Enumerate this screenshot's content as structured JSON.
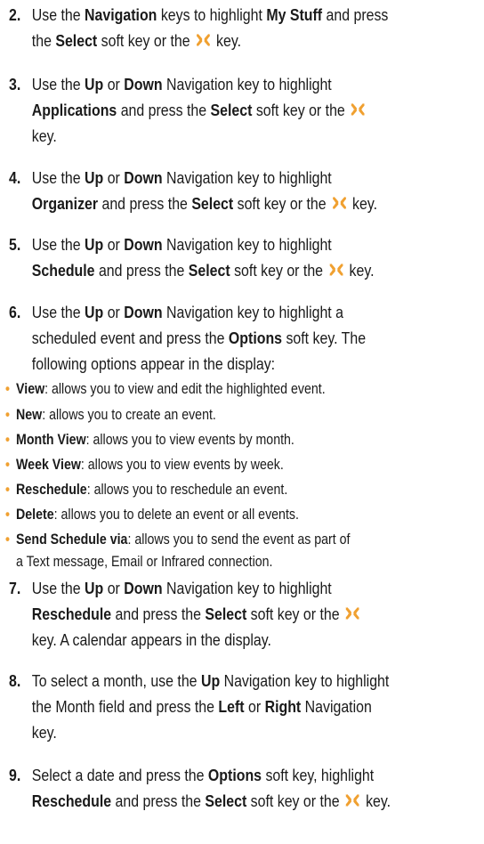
{
  "steps": [
    {
      "num": "2.",
      "lines": [
        [
          {
            "t": "Use the "
          },
          {
            "t": "Navigation",
            "b": true
          },
          {
            "t": " keys to highlight "
          },
          {
            "t": "My Stuff",
            "b": true
          },
          {
            "t": " and press"
          }
        ],
        [
          {
            "t": "the "
          },
          {
            "t": "Select",
            "b": true
          },
          {
            "t": " soft key or the "
          },
          {
            "icon": true
          },
          {
            "t": " key."
          }
        ]
      ]
    },
    {
      "num": "3.",
      "lines": [
        [
          {
            "t": "Use the "
          },
          {
            "t": "Up",
            "b": true
          },
          {
            "t": " or "
          },
          {
            "t": "Down",
            "b": true
          },
          {
            "t": " Navigation key to highlight"
          }
        ],
        [
          {
            "t": "Applications",
            "b": true
          },
          {
            "t": " and press the "
          },
          {
            "t": "Select",
            "b": true
          },
          {
            "t": " soft key or the "
          },
          {
            "icon": true
          }
        ],
        [
          {
            "t": "key."
          }
        ]
      ]
    },
    {
      "num": "4.",
      "lines": [
        [
          {
            "t": "Use the "
          },
          {
            "t": "Up",
            "b": true
          },
          {
            "t": " or "
          },
          {
            "t": "Down",
            "b": true
          },
          {
            "t": " Navigation key to highlight"
          }
        ],
        [
          {
            "t": "Organizer",
            "b": true
          },
          {
            "t": " and press the "
          },
          {
            "t": "Select",
            "b": true
          },
          {
            "t": " soft key or the "
          },
          {
            "icon": true
          },
          {
            "t": " key."
          }
        ]
      ]
    },
    {
      "num": "5.",
      "lines": [
        [
          {
            "t": "Use the "
          },
          {
            "t": "Up",
            "b": true
          },
          {
            "t": " or "
          },
          {
            "t": "Down",
            "b": true
          },
          {
            "t": " Navigation key to highlight"
          }
        ],
        [
          {
            "t": "Schedule",
            "b": true
          },
          {
            "t": " and press the "
          },
          {
            "t": "Select",
            "b": true
          },
          {
            "t": " soft key or the "
          },
          {
            "icon": true
          },
          {
            "t": " key."
          }
        ]
      ]
    },
    {
      "num": "6.",
      "lines": [
        [
          {
            "t": "Use the "
          },
          {
            "t": "Up",
            "b": true
          },
          {
            "t": " or "
          },
          {
            "t": "Down",
            "b": true
          },
          {
            "t": " Navigation key to highlight a"
          }
        ],
        [
          {
            "t": "scheduled event and press the "
          },
          {
            "t": "Options",
            "b": true
          },
          {
            "t": " soft key. The"
          }
        ],
        [
          {
            "t": "following options appear in the display:"
          }
        ]
      ]
    },
    {
      "num": "7.",
      "lines": [
        [
          {
            "t": "Use the "
          },
          {
            "t": "Up",
            "b": true
          },
          {
            "t": " or "
          },
          {
            "t": "Down",
            "b": true
          },
          {
            "t": " Navigation key to highlight"
          }
        ],
        [
          {
            "t": "Reschedule",
            "b": true
          },
          {
            "t": " and press the "
          },
          {
            "t": "Select",
            "b": true
          },
          {
            "t": " soft key or the "
          },
          {
            "icon": true
          }
        ],
        [
          {
            "t": "key. A calendar appears in the display."
          }
        ]
      ]
    },
    {
      "num": "8.",
      "lines": [
        [
          {
            "t": "To select a month, use the "
          },
          {
            "t": "Up",
            "b": true
          },
          {
            "t": " Navigation key to highlight"
          }
        ],
        [
          {
            "t": "the Month field and press the "
          },
          {
            "t": "Left",
            "b": true
          },
          {
            "t": " or "
          },
          {
            "t": "Right",
            "b": true
          },
          {
            "t": " Navigation"
          }
        ],
        [
          {
            "t": "key."
          }
        ]
      ]
    },
    {
      "num": "9.",
      "lines": [
        [
          {
            "t": "Select a date and press the "
          },
          {
            "t": "Options",
            "b": true
          },
          {
            "t": " soft key, highlight"
          }
        ],
        [
          {
            "t": "Reschedule",
            "b": true
          },
          {
            "t": " and press the "
          },
          {
            "t": "Select",
            "b": true
          },
          {
            "t": " soft key or the "
          },
          {
            "icon": true
          },
          {
            "t": " key."
          }
        ]
      ]
    }
  ],
  "options": [
    {
      "lines": [
        [
          {
            "t": "View",
            "b": true
          },
          {
            "t": ": allows you to view and edit the highlighted event."
          }
        ]
      ]
    },
    {
      "lines": [
        [
          {
            "t": "New",
            "b": true
          },
          {
            "t": ": allows you to create an event."
          }
        ]
      ]
    },
    {
      "lines": [
        [
          {
            "t": "Month View",
            "b": true
          },
          {
            "t": ": allows you to view events by month."
          }
        ]
      ]
    },
    {
      "lines": [
        [
          {
            "t": "Week View",
            "b": true
          },
          {
            "t": ": allows you to view events by week."
          }
        ]
      ]
    },
    {
      "lines": [
        [
          {
            "t": "Reschedule",
            "b": true
          },
          {
            "t": ": allows you to reschedule an event."
          }
        ]
      ]
    },
    {
      "lines": [
        [
          {
            "t": "Delete",
            "b": true
          },
          {
            "t": ": allows you to delete an event or all events."
          }
        ]
      ]
    },
    {
      "lines": [
        [
          {
            "t": "Send Schedule via",
            "b": true
          },
          {
            "t": ": allows you to send the event as part of"
          }
        ],
        [
          {
            "t": "a Text message, Email or Infrared connection."
          }
        ]
      ]
    }
  ],
  "bullet_glyph": "•",
  "icon_name": "select-key-icon",
  "colors": {
    "icon": "#f0a030",
    "bullet": "#f0a030"
  }
}
